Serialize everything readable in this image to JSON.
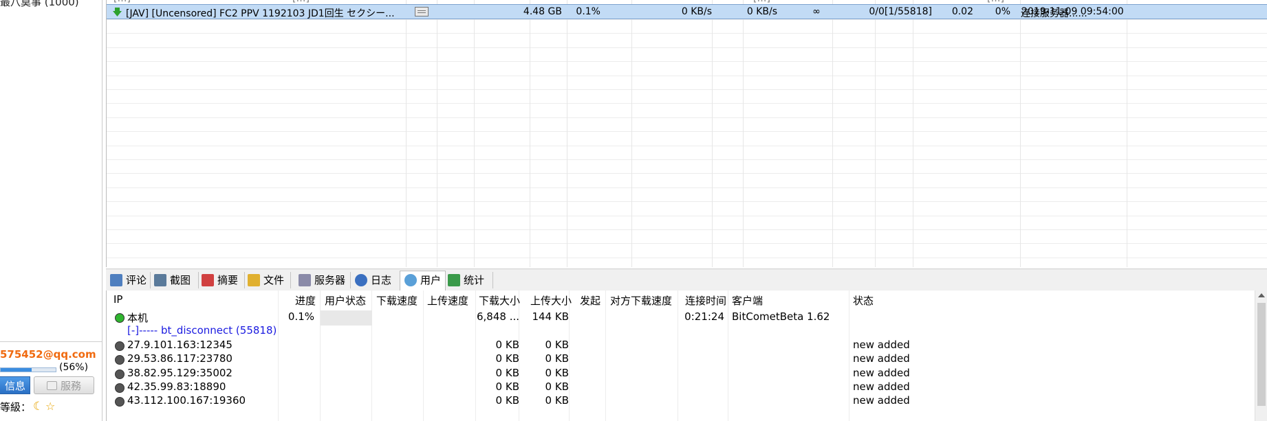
{
  "left_panel": {
    "top_item": "最八莫事 (1000)",
    "email": "575452@qq.com",
    "quota_percent_text": "(56%)",
    "quota_fraction": 0.56,
    "info_button": "信息",
    "service_button": "服務",
    "level_label": "等級：",
    "level_icons": [
      "moon-icon",
      "star-icon"
    ]
  },
  "torrent_list": {
    "partial_row": [
      "[…]",
      "[…]",
      "[…]",
      "[…]"
    ],
    "selected_row": {
      "name": "[JAV] [Uncensored] FC2 PPV 1192103 JD1回生 セクシー...",
      "size": "4.48 GB",
      "progress": "0.1%",
      "download_speed": "0 KB/s",
      "upload_speed": "0 KB/s",
      "remaining": "∞",
      "seeds_peers": "0/0[1/55818]",
      "share_ratio": "0.02",
      "health": "0%",
      "status": "连接服务器......",
      "added_time": "2019-11-09 09:54:00"
    }
  },
  "tabs": [
    {
      "label": "评论",
      "icon": "comment-icon",
      "color": "#4f7fbf"
    },
    {
      "label": "截图",
      "icon": "screenshot-icon",
      "color": "#5a7a9a"
    },
    {
      "label": "摘要",
      "icon": "summary-icon",
      "color": "#d04040"
    },
    {
      "label": "文件",
      "icon": "file-icon",
      "color": "#e0b030"
    },
    {
      "label": "服务器",
      "icon": "server-icon",
      "color": "#8a8aa8"
    },
    {
      "label": "日志",
      "icon": "log-icon",
      "color": "#3a6fc0"
    },
    {
      "label": "用户",
      "icon": "user-icon",
      "color": "#5aa0d8"
    },
    {
      "label": "统计",
      "icon": "stats-icon",
      "color": "#3a9a4a"
    }
  ],
  "peers": {
    "headers": [
      "IP",
      "进度",
      "用户状态",
      "下载速度",
      "上传速度",
      "下载大小",
      "上传大小",
      "发起",
      "对方下载速度",
      "连接时间",
      "客户端",
      "状态"
    ],
    "local": {
      "ip": "本机",
      "progress": "0.1%",
      "download_size": "6,848 ...",
      "upload_size": "144 KB",
      "connect_time": "0:21:24",
      "client": "BitCometBeta 1.62"
    },
    "group": "[-]----- bt_disconnect (55818)",
    "rows": [
      {
        "ip": "27.9.101.163:12345",
        "download_size": "0 KB",
        "upload_size": "0 KB",
        "status": "new added"
      },
      {
        "ip": "29.53.86.117:23780",
        "download_size": "0 KB",
        "upload_size": "0 KB",
        "status": "new added"
      },
      {
        "ip": "38.82.95.129:35002",
        "download_size": "0 KB",
        "upload_size": "0 KB",
        "status": "new added"
      },
      {
        "ip": "42.35.99.83:18890",
        "download_size": "0 KB",
        "upload_size": "0 KB",
        "status": "new added"
      },
      {
        "ip": "43.112.100.167:19360",
        "download_size": "0 KB",
        "upload_size": "0 KB",
        "status": "new added"
      }
    ]
  },
  "colors": {
    "selected_row": "#c2dbf5",
    "email": "#f06a0f",
    "group_link": "#1a1ae0",
    "local_icon": "#2fb52f",
    "peer_icon": "#555555"
  }
}
